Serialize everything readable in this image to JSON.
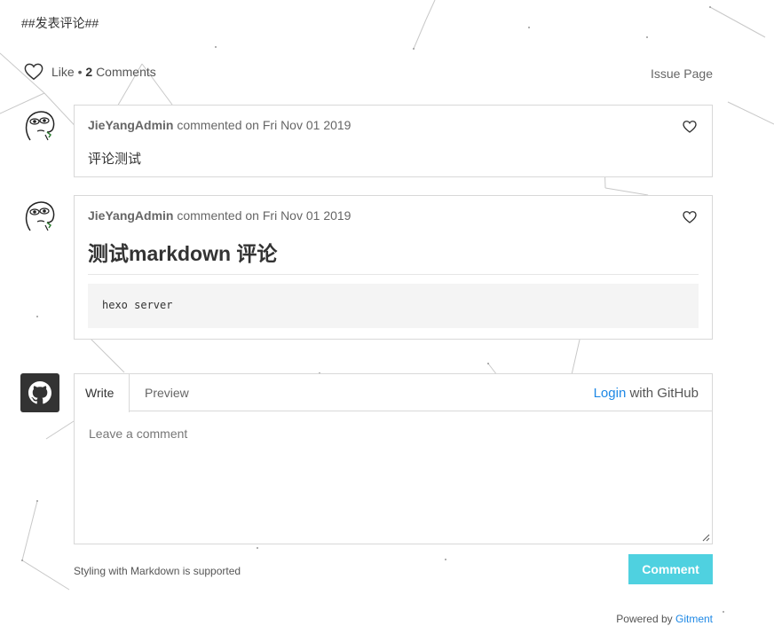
{
  "section_title": "##发表评论##",
  "header": {
    "like_label": "Like",
    "bullet": "•",
    "comments_count": "2",
    "comments_label": "Comments",
    "issue_page_label": "Issue Page"
  },
  "comments": [
    {
      "author": "JieYangAdmin",
      "meta": "commented on Fri Nov 01 2019",
      "body_text": "评论测试"
    },
    {
      "author": "JieYangAdmin",
      "meta": "commented on Fri Nov 01 2019",
      "heading": "测试markdown 评论",
      "code": "hexo server"
    }
  ],
  "editor": {
    "tab_write": "Write",
    "tab_preview": "Preview",
    "login_link": "Login",
    "login_suffix": " with GitHub",
    "placeholder": "Leave a comment"
  },
  "footer": {
    "markdown_note": "Styling with Markdown is supported",
    "comment_button": "Comment",
    "powered_prefix": "Powered by ",
    "powered_brand": "Gitment"
  },
  "colors": {
    "accent_button": "#4fd1e0",
    "link": "#1e88e5",
    "border": "#d8d8d8"
  },
  "icons": {
    "like": "heart-icon",
    "comment_like": "heart-icon",
    "avatar": "meme-face-avatar",
    "login_avatar": "github-icon"
  }
}
